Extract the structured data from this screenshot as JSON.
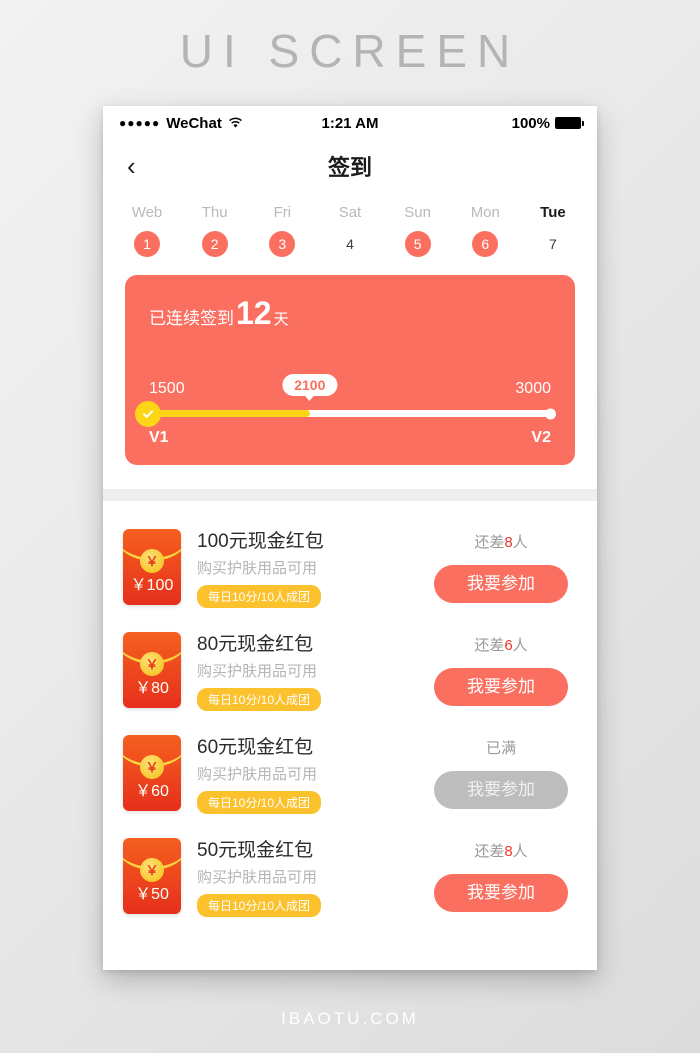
{
  "poster": {
    "title": "UI SCREEN",
    "footer": "IBAOTU.COM"
  },
  "statusbar": {
    "signal_dots": "●●●●●",
    "carrier": "WeChat",
    "time": "1:21 AM",
    "battery_percent": "100%"
  },
  "navbar": {
    "back_icon": "‹",
    "title": "签到"
  },
  "week": {
    "days": [
      {
        "name": "Web",
        "num": "1",
        "signed": true,
        "today": false
      },
      {
        "name": "Thu",
        "num": "2",
        "signed": true,
        "today": false
      },
      {
        "name": "Fri",
        "num": "3",
        "signed": true,
        "today": false
      },
      {
        "name": "Sat",
        "num": "4",
        "signed": false,
        "today": false
      },
      {
        "name": "Sun",
        "num": "5",
        "signed": true,
        "today": false
      },
      {
        "name": "Mon",
        "num": "6",
        "signed": true,
        "today": false
      },
      {
        "name": "Tue",
        "num": "7",
        "signed": false,
        "today": true
      }
    ]
  },
  "banner": {
    "prefix": "已连续签到",
    "days": "12",
    "suffix": "天",
    "progress": {
      "start_value": "1500",
      "current_value": "2100",
      "end_value": "3000",
      "start_tier": "V1",
      "end_tier": "V2",
      "fill_percent": 40
    },
    "bg_color": "#fb6f61",
    "fill_color": "#fcd616"
  },
  "list": {
    "items": [
      {
        "amount_label": "￥100",
        "coin_symbol": "￥",
        "title": "100元现金红包",
        "subtitle": "购买护肤用品可用",
        "badge": "每日10分/10人成团",
        "status_prefix": "还差",
        "status_count": "8",
        "status_suffix": "人",
        "button_label": "我要参加",
        "disabled": false
      },
      {
        "amount_label": "￥80",
        "coin_symbol": "￥",
        "title": "80元现金红包",
        "subtitle": "购买护肤用品可用",
        "badge": "每日10分/10人成团",
        "status_prefix": "还差",
        "status_count": "6",
        "status_suffix": "人",
        "button_label": "我要参加",
        "disabled": false
      },
      {
        "amount_label": "￥60",
        "coin_symbol": "￥",
        "title": "60元现金红包",
        "subtitle": "购买护肤用品可用",
        "badge": "每日10分/10人成团",
        "status_prefix": "已满",
        "status_count": "",
        "status_suffix": "",
        "button_label": "我要参加",
        "disabled": true
      },
      {
        "amount_label": "￥50",
        "coin_symbol": "￥",
        "title": "50元现金红包",
        "subtitle": "购买护肤用品可用",
        "badge": "每日10分/10人成团",
        "status_prefix": "还差",
        "status_count": "8",
        "status_suffix": "人",
        "button_label": "我要参加",
        "disabled": false
      }
    ]
  }
}
